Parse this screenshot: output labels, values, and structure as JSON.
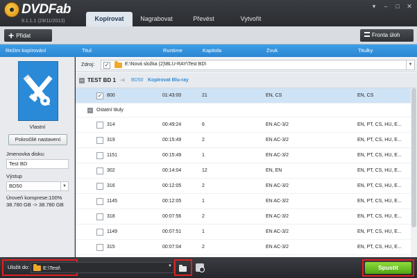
{
  "app": {
    "brand": "DVDFab",
    "version": "9.1.1.1 (29/11/2013)"
  },
  "tabs": [
    {
      "label": "Kopírovat",
      "active": true
    },
    {
      "label": "Nagrabovat",
      "active": false
    },
    {
      "label": "Převést",
      "active": false
    },
    {
      "label": "Vytvořit",
      "active": false
    }
  ],
  "window_buttons": [
    "▾",
    "–",
    "□",
    "✕"
  ],
  "toolbar": {
    "add_label": "Přidat",
    "queue_label": "Fronta úloh"
  },
  "headers": {
    "mode": "Režim kopírování",
    "title": "Titul",
    "runtime": "Runtime",
    "chapter": "Kapitola",
    "audio": "Zvuk",
    "subtitles": "Titulky"
  },
  "left_panel": {
    "mode_label": "Vlastní",
    "advanced_button": "Pokročilé nastavení",
    "volume_label": "Jmenovka disku:",
    "volume_value": "Test BD",
    "output_label": "Výstup",
    "output_value": "BD50",
    "compression_label": "Úroveň komprese:100%",
    "compression_sizes": "38.780 GB -> 38.780 GB"
  },
  "source": {
    "label": "Zdroj:",
    "path": "E:\\Nová složka (2)\\BLU-RAY\\Test BD\\"
  },
  "group": {
    "name": "TEST BD 1",
    "disc": "BD50",
    "mode": "Kopírovat Blu-ray"
  },
  "main_title": {
    "title": "800",
    "runtime": "01:43:00",
    "chapters": "21",
    "audio": "EN, CS",
    "subs": "EN, CS"
  },
  "other_titles_label": "Ostatní tituly",
  "other_titles": [
    {
      "title": "314",
      "runtime": "00:49:24",
      "chapters": "6",
      "audio": "EN AC-3/2",
      "subs": "EN, PT, CS, HU, E..."
    },
    {
      "title": "319",
      "runtime": "00:15:49",
      "chapters": "2",
      "audio": "EN AC-3/2",
      "subs": "EN, PT, CS, HU, E..."
    },
    {
      "title": "1151",
      "runtime": "00:15:49",
      "chapters": "1",
      "audio": "EN AC-3/2",
      "subs": "EN, PT, CS, HU, E..."
    },
    {
      "title": "302",
      "runtime": "00:14:04",
      "chapters": "12",
      "audio": "EN, EN",
      "subs": "EN, PT, CS, HU, E..."
    },
    {
      "title": "316",
      "runtime": "00:12:05",
      "chapters": "2",
      "audio": "EN AC-3/2",
      "subs": "EN, PT, CS, HU, E..."
    },
    {
      "title": "1145",
      "runtime": "00:12:05",
      "chapters": "1",
      "audio": "EN AC-3/2",
      "subs": "EN, PT, CS, HU, E..."
    },
    {
      "title": "318",
      "runtime": "00:07:56",
      "chapters": "2",
      "audio": "EN AC-3/2",
      "subs": "EN, PT, CS, HU, E..."
    },
    {
      "title": "1149",
      "runtime": "00:07:51",
      "chapters": "1",
      "audio": "EN AC-3/2",
      "subs": "EN, PT, CS, HU, E..."
    },
    {
      "title": "315",
      "runtime": "00:07:04",
      "chapters": "2",
      "audio": "EN AC-3/2",
      "subs": "EN, PT, CS, HU, E..."
    }
  ],
  "bottom": {
    "save_label": "Uložit do:",
    "save_path": "E:\\Test\\",
    "start_label": "Spustit"
  },
  "colors": {
    "accent_blue": "#2a8ad8",
    "start_green": "#5cb81e",
    "highlight_red": "#e02020"
  }
}
